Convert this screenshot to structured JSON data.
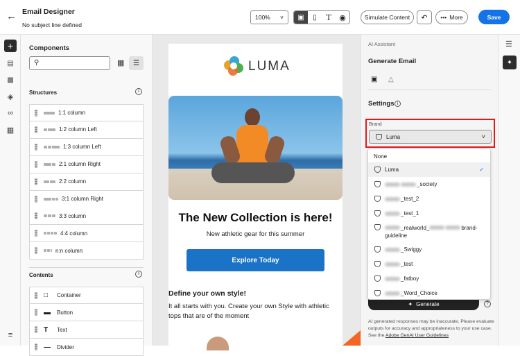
{
  "header": {
    "title": "Email Designer",
    "subtitle": "No subject line defined",
    "zoom": "100%",
    "simulate": "Simulate Content",
    "more": "More",
    "save": "Save"
  },
  "components": {
    "title": "Components",
    "structures_title": "Structures",
    "contents_title": "Contents",
    "structures": [
      "1:1 column",
      "1:2 column Left",
      "1:3 column Left",
      "2:1 column Right",
      "2:2 column",
      "3:1 column Right",
      "3:3 column",
      "4:4 column",
      "n:n column"
    ],
    "contents": [
      "Container",
      "Button",
      "Text",
      "Divider"
    ]
  },
  "email": {
    "brand": "LUMA",
    "headline": "The New Collection is here!",
    "subhead": "New athletic gear for this summer",
    "cta": "Explore Today",
    "section_title": "Define your own style!",
    "section_body": "It all starts with you. Create your own Style with athletic tops that are of the moment"
  },
  "ai": {
    "label": "AI Assistant",
    "title": "Generate Email",
    "settings": "Settings",
    "brand_label": "Brand",
    "brand_value": "Luma",
    "generate": "Generate",
    "disclaimer": "AI generated responses may be inaccurate. Please evaluate outputs for accuracy and appropriateness to your use case. See the",
    "disclaimer_link": "Adobe GenAI User Guidelines",
    "options": [
      "None",
      "Luma",
      "_society",
      "_test_2",
      "_test_1",
      "_realworld_",
      "brand-guideline",
      "_Swiggy",
      "_test",
      "_fatboy",
      "_Word_Choice"
    ]
  },
  "colors": {
    "accent": "#1473e6",
    "cta": "#1a73c7",
    "highlight": "#e3191c"
  }
}
